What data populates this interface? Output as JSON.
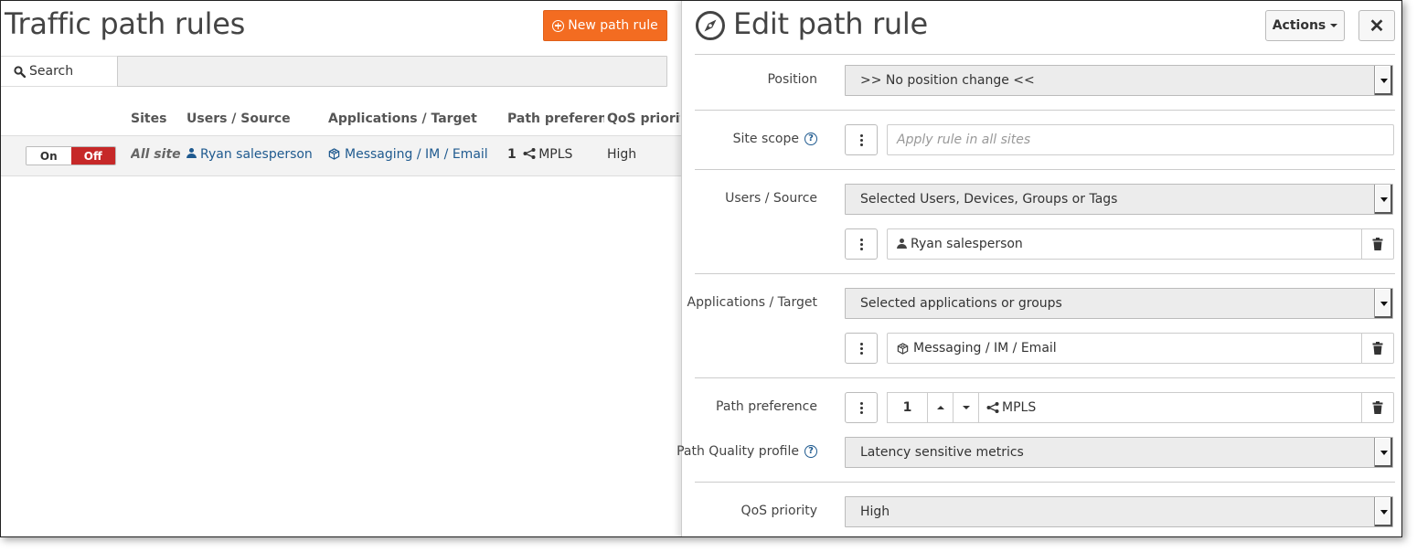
{
  "left": {
    "title": "Traffic path rules",
    "new_button": "New path rule",
    "search_label": "Search",
    "search_value": "",
    "columns": [
      "Sites",
      "Users / Source",
      "Applications / Target",
      "Path preference",
      "QoS priority"
    ],
    "row": {
      "toggle_on": "On",
      "toggle_off": "Off",
      "sites": "All sites",
      "users": "Ryan salesperson",
      "applications": "Messaging / IM / Email",
      "path_rank": "1",
      "path_name": "MPLS",
      "qos": "High"
    }
  },
  "editor": {
    "title": "Edit path rule",
    "actions_label": "Actions",
    "close_label": "✕",
    "position": {
      "label": "Position",
      "value": ">> No position change <<"
    },
    "site_scope": {
      "label": "Site scope",
      "help": "?",
      "placeholder": "Apply rule in all sites"
    },
    "users_source": {
      "label": "Users / Source",
      "value": "Selected Users, Devices, Groups or Tags",
      "item": "Ryan salesperson"
    },
    "applications_target": {
      "label": "Applications / Target",
      "value": "Selected applications or groups",
      "item": "Messaging / IM / Email"
    },
    "path_preference": {
      "label": "Path preference",
      "rank": "1",
      "target": "MPLS"
    },
    "path_quality": {
      "label": "Path Quality profile",
      "help": "?",
      "value": "Latency sensitive metrics"
    },
    "qos_priority": {
      "label": "QoS priority",
      "value": "High"
    }
  },
  "colors": {
    "accent_orange": "#f36c21",
    "off_red": "#c62828",
    "link_blue": "#1f5a8f"
  },
  "icons": [
    "plus-circle-icon",
    "search-icon",
    "user-icon",
    "cube-icon",
    "share-icon",
    "compass-icon",
    "caret-down-icon",
    "close-icon",
    "help-icon",
    "kebab-icon",
    "trash-icon",
    "arrow-up-icon",
    "arrow-down-icon"
  ]
}
